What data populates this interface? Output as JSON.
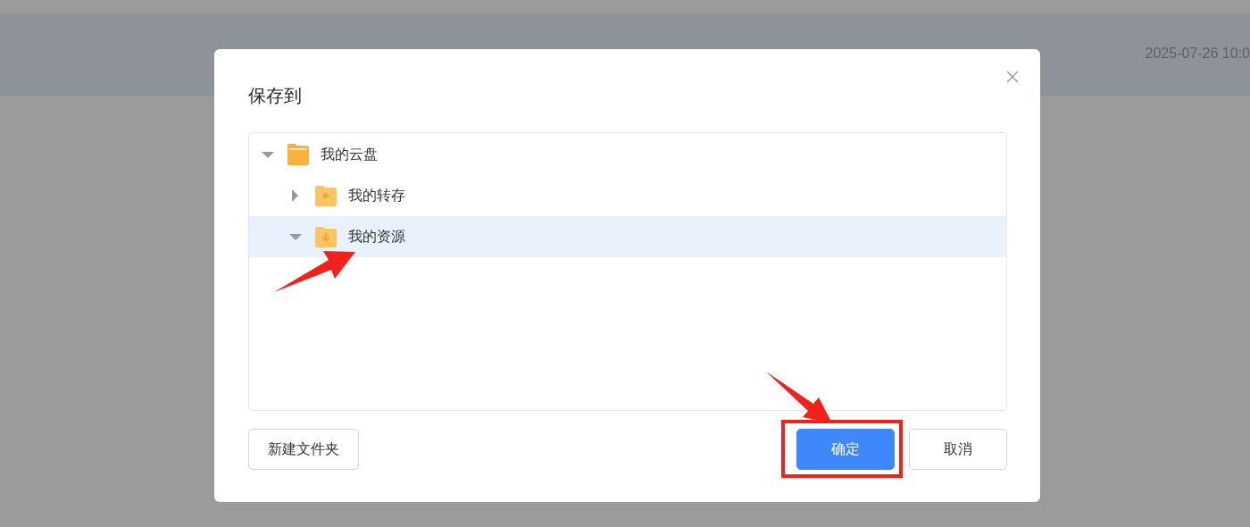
{
  "background_row": {
    "date": "2025-07-26 10:0"
  },
  "dialog": {
    "title": "保存到",
    "tree": [
      {
        "label": "我的云盘",
        "kind": "folder",
        "expanded": true,
        "selected": false,
        "children": [
          {
            "label": "我的转存",
            "kind": "transfer",
            "expanded": false,
            "selected": false
          },
          {
            "label": "我的资源",
            "kind": "resource",
            "expanded": true,
            "selected": true
          }
        ]
      }
    ],
    "buttons": [
      {
        "label": "新建文件夹",
        "kind": "default"
      },
      {
        "label": "确定",
        "kind": "primary"
      },
      {
        "label": "取消",
        "kind": "default"
      }
    ]
  }
}
